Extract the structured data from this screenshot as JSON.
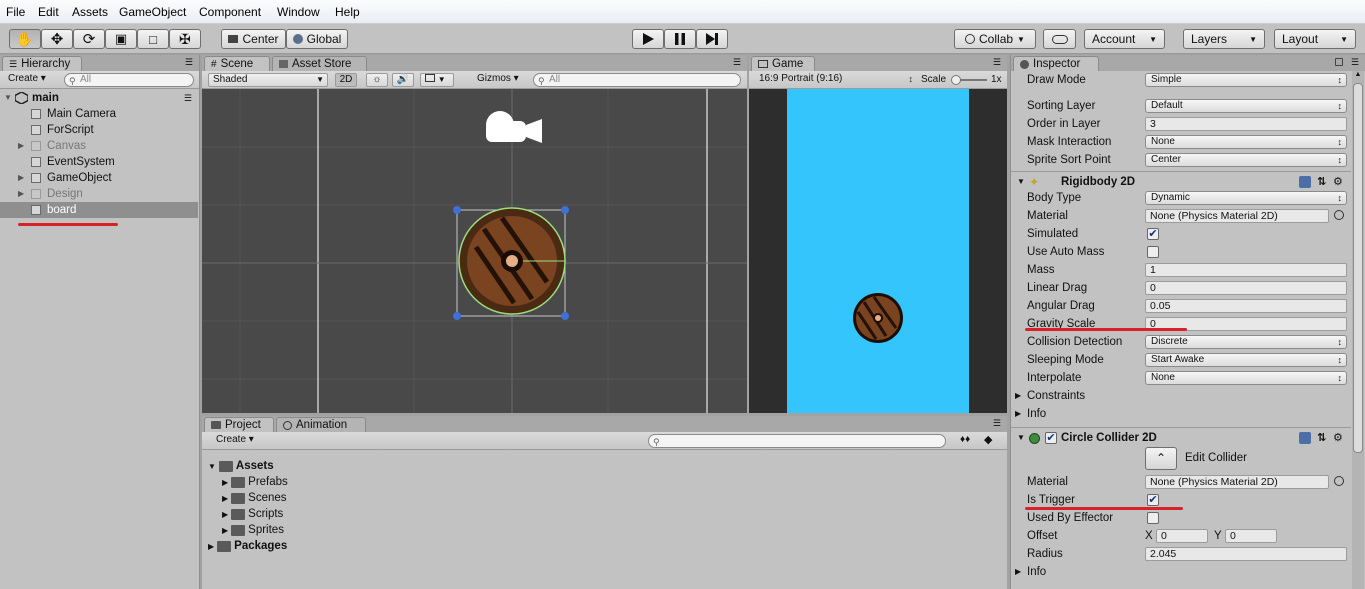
{
  "menu": [
    "File",
    "Edit",
    "Assets",
    "GameObject",
    "Component",
    "Window",
    "Help"
  ],
  "toolbar": {
    "pivot_label": "Center",
    "space_label": "Global",
    "collab_label": "Collab",
    "account_label": "Account",
    "layers_label": "Layers",
    "layout_label": "Layout"
  },
  "hierarchy": {
    "tab": "Hierarchy",
    "create": "Create",
    "search_placeholder": "All",
    "scene": "main",
    "items": [
      {
        "label": "Main Camera",
        "dim": false,
        "expandable": false
      },
      {
        "label": "ForScript",
        "dim": false,
        "expandable": false
      },
      {
        "label": "Canvas",
        "dim": true,
        "expandable": true
      },
      {
        "label": "EventSystem",
        "dim": false,
        "expandable": false
      },
      {
        "label": "GameObject",
        "dim": false,
        "expandable": true
      },
      {
        "label": "Design",
        "dim": true,
        "expandable": true
      },
      {
        "label": "board",
        "dim": false,
        "expandable": false,
        "selected": true
      }
    ]
  },
  "scene": {
    "tab": "Scene",
    "tab2": "Asset Store",
    "shading": "Shaded",
    "mode_2d": "2D",
    "gizmos": "Gizmos",
    "search_placeholder": "All"
  },
  "game": {
    "tab": "Game",
    "aspect": "16:9 Portrait (9:16)",
    "scale_label": "Scale",
    "scale_value": "1x"
  },
  "project": {
    "tab": "Project",
    "tab2": "Animation",
    "create": "Create",
    "tree": {
      "root": "Assets",
      "children": [
        "Prefabs",
        "Scenes",
        "Scripts",
        "Sprites"
      ],
      "root2": "Packages"
    }
  },
  "inspector": {
    "tab": "Inspector",
    "sprite_renderer": {
      "draw_mode_label": "Draw Mode",
      "draw_mode": "Simple",
      "sorting_layer_label": "Sorting Layer",
      "sorting_layer": "Default",
      "order_label": "Order in Layer",
      "order": "3",
      "mask_label": "Mask Interaction",
      "mask": "None",
      "sort_point_label": "Sprite Sort Point",
      "sort_point": "Center"
    },
    "rigidbody": {
      "title": "Rigidbody 2D",
      "body_type_label": "Body Type",
      "body_type": "Dynamic",
      "material_label": "Material",
      "material": "None (Physics Material 2D)",
      "simulated_label": "Simulated",
      "simulated": true,
      "auto_mass_label": "Use Auto Mass",
      "auto_mass": false,
      "mass_label": "Mass",
      "mass": "1",
      "linear_drag_label": "Linear Drag",
      "linear_drag": "0",
      "angular_drag_label": "Angular Drag",
      "angular_drag": "0.05",
      "gravity_label": "Gravity Scale",
      "gravity": "0",
      "collision_label": "Collision Detection",
      "collision": "Discrete",
      "sleeping_label": "Sleeping Mode",
      "sleeping": "Start Awake",
      "interpolate_label": "Interpolate",
      "interpolate": "None",
      "constraints_label": "Constraints",
      "info_label": "Info"
    },
    "collider": {
      "title": "Circle Collider 2D",
      "enabled": true,
      "edit_label": "Edit Collider",
      "material_label": "Material",
      "material": "None (Physics Material 2D)",
      "trigger_label": "Is Trigger",
      "is_trigger": true,
      "effector_label": "Used By Effector",
      "effector": false,
      "offset_label": "Offset",
      "offset_x_label": "X",
      "offset_x": "0",
      "offset_y_label": "Y",
      "offset_y": "0",
      "radius_label": "Radius",
      "radius": "2.045",
      "info_label": "Info"
    }
  }
}
